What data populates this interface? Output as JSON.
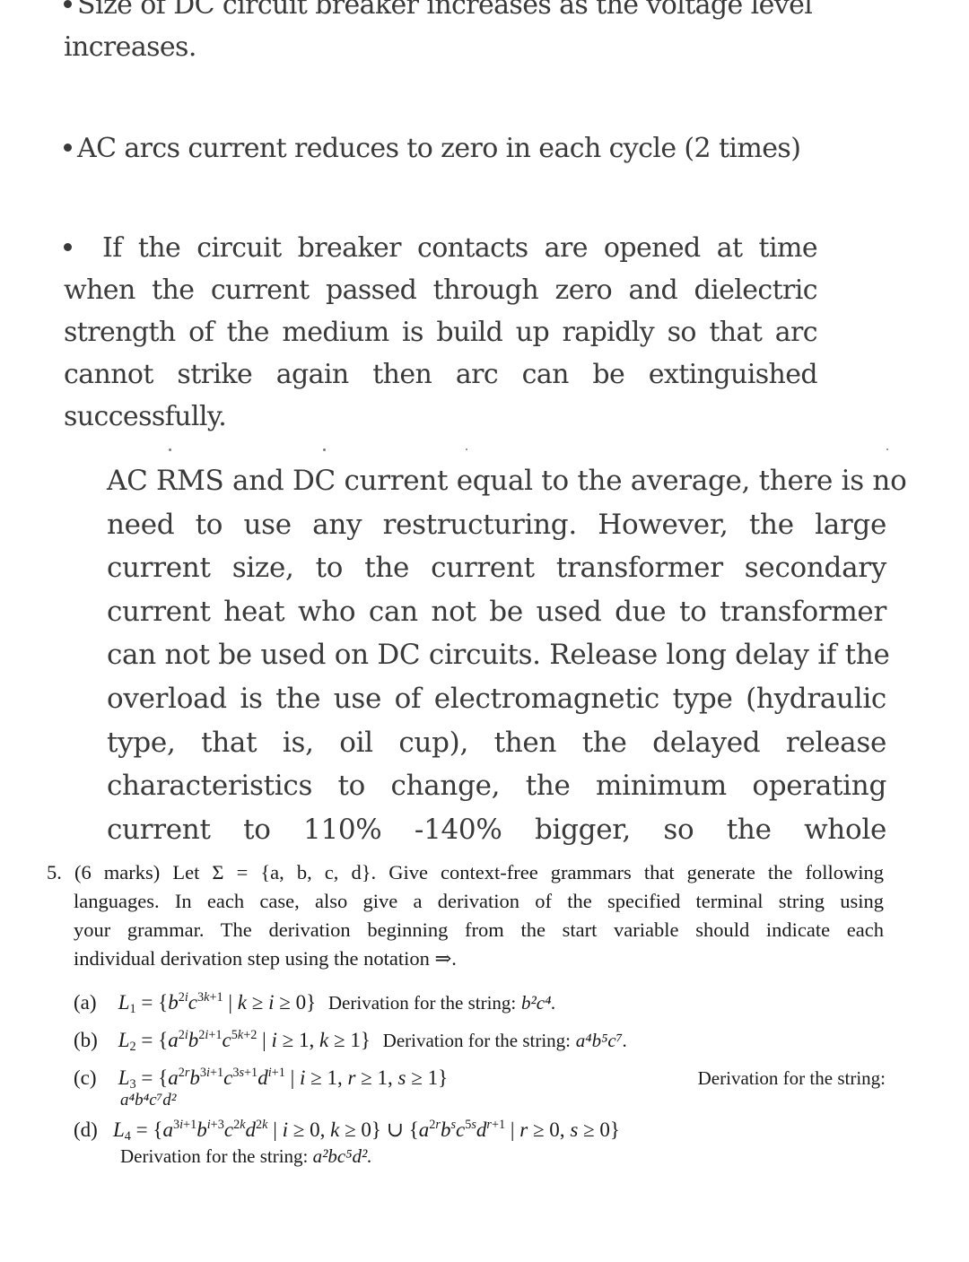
{
  "bullets": [
    {
      "icon": "bullet-dot",
      "lines": [
        "Size of DC circuit breaker increases as the voltage level",
        "increases."
      ]
    },
    {
      "icon": "bullet-dot",
      "lines": [
        "AC arcs current reduces to zero in each cycle (2 times)"
      ]
    },
    {
      "icon": "bullet-dot",
      "lines": [
        "If the circuit breaker contacts are opened at time",
        "when the current passed through zero and dielectric",
        "strength of the medium is build up rapidly so that arc",
        "cannot strike again then arc can be extinguished",
        "successfully."
      ]
    }
  ],
  "paragraph": {
    "lines": [
      "AC RMS and DC current equal to the average, there is no",
      "need to use any restructuring. However, the large",
      "current size, to the current transformer secondary",
      "current heat who can not be used due to transformer",
      "can not be used on DC circuits. Release long delay if the",
      "overload is the use of electromagnetic type (hydraulic",
      "type, that is, oil cup), then the delayed release",
      "characteristics to change, the minimum operating",
      "current to 110% -140% bigger, so the whole"
    ]
  },
  "question": {
    "number": "5.",
    "marks": "(6 marks)",
    "intro_prefix": "Let Σ = {a, b, c, d}.",
    "intro_lines": [
      "Give context-free grammars that generate the following",
      "languages.  In each case, also give a derivation of the specified terminal string using",
      "your grammar.  The derivation beginning from the start variable should indicate each",
      "individual derivation step using the notation ⇒."
    ],
    "parts": [
      {
        "label": "(a)",
        "language": "L₁ = {b^(2i) c^(3k+1) | k ≥ i ≥ 0}",
        "derivation_label": "Derivation for the string:",
        "string": "b²c⁴."
      },
      {
        "label": "(b)",
        "language": "L₂ = {a^(2i) b^(2i+1) c^(5k+2) | i ≥ 1, k ≥ 1}",
        "derivation_label": "Derivation for the string:",
        "string": "a⁴b⁵c⁷."
      },
      {
        "label": "(c)",
        "language": "L₃ = {a^(2r) b^(3i+1) c^(3s+1) d^(i+1) | i ≥ 1, r ≥ 1, s ≥ 1}",
        "derivation_label": "Derivation for the string:",
        "string": "a⁴b⁴c⁷d²"
      },
      {
        "label": "(d)",
        "language": "L₄ = {a^(3i+1) b^(i+3) c^(2k) d^(2k) | i ≥ 0, k ≥ 0} ∪ {a^(2r) b^s c^(5s) d^(r+1) | r ≥ 0, s ≥ 0}",
        "derivation_label": "Derivation for the string:",
        "string": "a²bc⁵d²."
      }
    ]
  }
}
